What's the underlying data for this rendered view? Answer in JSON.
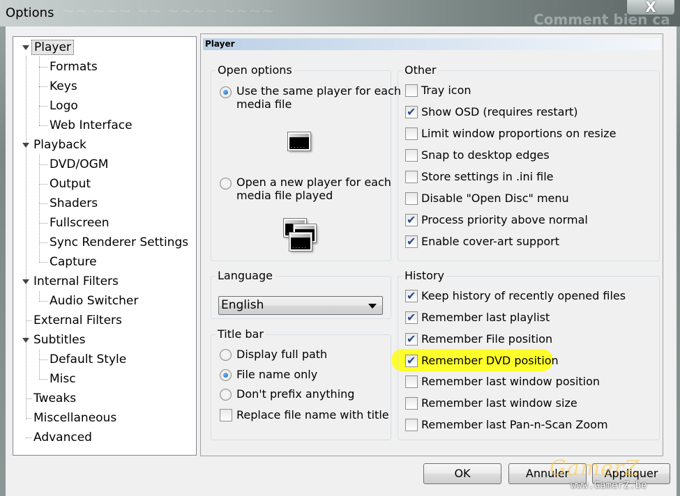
{
  "window": {
    "title": "Options",
    "background_text": "Comment bien ca"
  },
  "tree": {
    "items": [
      {
        "label": "Player",
        "selected": true
      },
      {
        "label": "Formats"
      },
      {
        "label": "Keys"
      },
      {
        "label": "Logo"
      },
      {
        "label": "Web Interface"
      },
      {
        "label": "Playback"
      },
      {
        "label": "DVD/OGM"
      },
      {
        "label": "Output"
      },
      {
        "label": "Shaders"
      },
      {
        "label": "Fullscreen"
      },
      {
        "label": "Sync Renderer Settings"
      },
      {
        "label": "Capture"
      },
      {
        "label": "Internal Filters"
      },
      {
        "label": "Audio Switcher"
      },
      {
        "label": "External Filters"
      },
      {
        "label": "Subtitles"
      },
      {
        "label": "Default Style"
      },
      {
        "label": "Misc"
      },
      {
        "label": "Tweaks"
      },
      {
        "label": "Miscellaneous"
      },
      {
        "label": "Advanced"
      }
    ]
  },
  "panel": {
    "header": "Player",
    "open_options": {
      "title": "Open options",
      "same_player": {
        "line1": "Use the same player for each",
        "line2": "media file",
        "selected": true
      },
      "new_player": {
        "line1": "Open a new player for each",
        "line2": "media file played",
        "selected": false
      }
    },
    "language": {
      "title": "Language",
      "selected": "English"
    },
    "title_bar": {
      "title": "Title bar",
      "full_path": {
        "label": "Display full path",
        "selected": false
      },
      "file_name_only": {
        "label": "File name only",
        "selected": true
      },
      "dont_prefix": {
        "label": "Don't prefix anything",
        "selected": false
      },
      "replace_name": {
        "label": "Replace file name with title",
        "checked": false
      }
    },
    "other": {
      "title": "Other",
      "items": [
        {
          "label": "Tray icon",
          "checked": false
        },
        {
          "label": "Show OSD (requires restart)",
          "checked": true
        },
        {
          "label": "Limit window proportions on resize",
          "checked": false
        },
        {
          "label": "Snap to desktop edges",
          "checked": false
        },
        {
          "label": "Store settings in .ini file",
          "checked": false
        },
        {
          "label": "Disable \"Open Disc\" menu",
          "checked": false
        },
        {
          "label": "Process priority above normal",
          "checked": true
        },
        {
          "label": "Enable cover-art support",
          "checked": true
        }
      ]
    },
    "history": {
      "title": "History",
      "items": [
        {
          "label": "Keep history of recently opened files",
          "checked": true
        },
        {
          "label": "Remember last playlist",
          "checked": true
        },
        {
          "label": "Remember File position",
          "checked": true
        },
        {
          "label": "Remember DVD position",
          "checked": true
        },
        {
          "label": "Remember last window position",
          "checked": false
        },
        {
          "label": "Remember last window size",
          "checked": false
        },
        {
          "label": "Remember last Pan-n-Scan Zoom",
          "checked": false
        }
      ]
    }
  },
  "buttons": {
    "ok": "OK",
    "cancel": "Annuler",
    "apply": "Appliquer",
    "close": "X"
  },
  "watermark": {
    "logo": "GamerZ",
    "url": "www.GamerZ.be"
  },
  "colors": {
    "highlight": "#ffff2a",
    "selection_bg": "#e6e6e6",
    "panel_header": "#bcd0e6"
  }
}
